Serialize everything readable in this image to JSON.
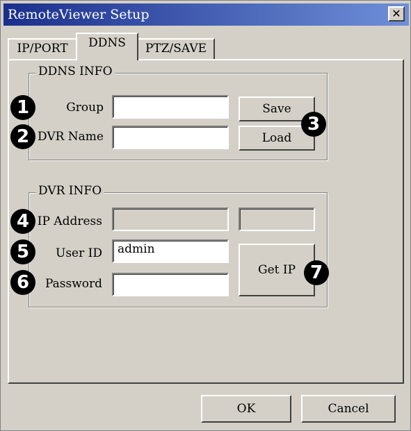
{
  "window": {
    "title": "RemoteViewer Setup",
    "close_glyph": "✕"
  },
  "tabs": [
    {
      "label": "IP/PORT",
      "active": false
    },
    {
      "label": "DDNS",
      "active": true
    },
    {
      "label": "PTZ/SAVE",
      "active": false
    }
  ],
  "ddns_info": {
    "title": "DDNS INFO",
    "group_label": "Group",
    "group_value": "",
    "dvr_name_label": "DVR Name",
    "dvr_name_value": "",
    "save_label": "Save",
    "load_label": "Load"
  },
  "dvr_info": {
    "title": "DVR INFO",
    "ip_address_label": "IP Address",
    "ip_address_value": "",
    "port_value": "",
    "user_id_label": "User ID",
    "user_id_value": "admin",
    "password_label": "Password",
    "password_value": "",
    "get_ip_label": "Get IP"
  },
  "footer": {
    "ok_label": "OK",
    "cancel_label": "Cancel"
  },
  "callouts": [
    "1",
    "2",
    "3",
    "4",
    "5",
    "6",
    "7"
  ]
}
